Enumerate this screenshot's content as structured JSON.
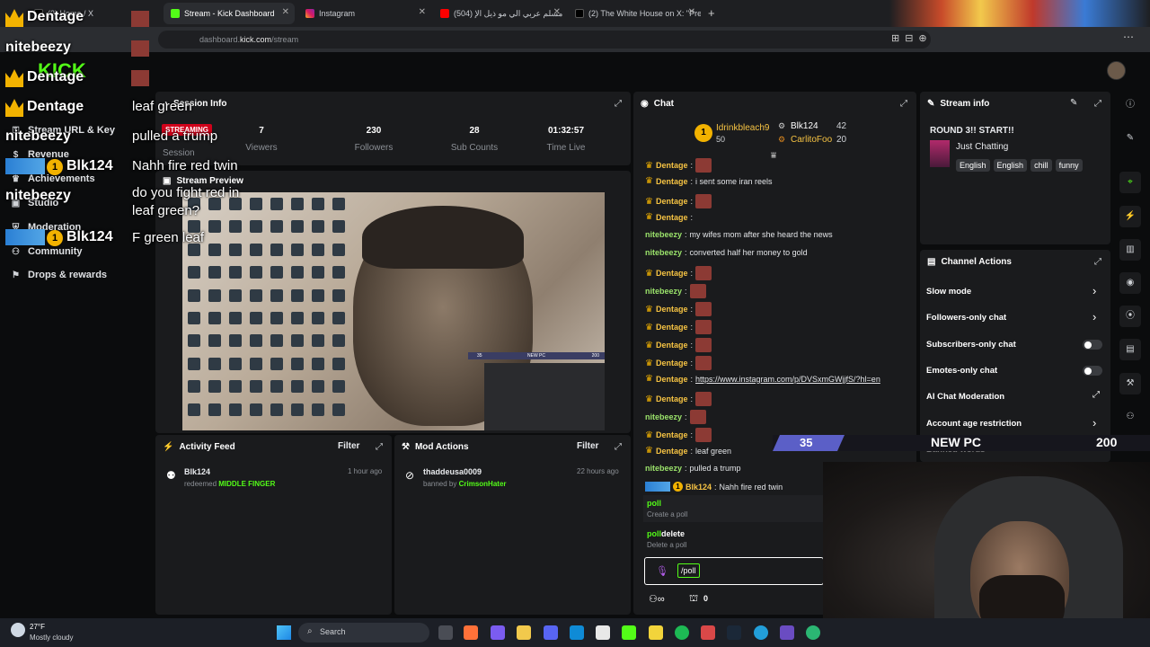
{
  "browser": {
    "tabs": [
      {
        "label": "(2) Home / X"
      },
      {
        "label": "Stream - Kick Dashboard"
      },
      {
        "label": "Instagram"
      },
      {
        "label": "(504) مسلم عربي الي مو ذيل الإ"
      },
      {
        "label": "(2) The White House on X: \"Pre"
      }
    ],
    "url_prefix": "dashboard.",
    "url_domain": "kick.com",
    "url_path": "/stream"
  },
  "sidebar": {
    "items": [
      {
        "label": "Stream URL & Key"
      },
      {
        "label": "Revenue"
      },
      {
        "label": "Achievements"
      },
      {
        "label": "Studio"
      },
      {
        "label": "Moderation"
      },
      {
        "label": "Community"
      },
      {
        "label": "Drops & rewards"
      }
    ]
  },
  "session": {
    "title": "Session Info",
    "status": "STREAMING",
    "session_label": "Session",
    "stats": [
      {
        "value": "7",
        "label": "Viewers"
      },
      {
        "value": "230",
        "label": "Followers"
      },
      {
        "value": "28",
        "label": "Sub Counts"
      },
      {
        "value": "01:32:57",
        "label": "Time Live"
      }
    ]
  },
  "preview": {
    "title": "Stream Preview",
    "overlay_left": "35",
    "overlay_mid": "NEW PC",
    "overlay_right": "200"
  },
  "activity": {
    "title": "Activity Feed",
    "filter": "Filter",
    "item_user": "Blk124",
    "item_time": "1 hour ago",
    "item_action": "redeemed",
    "item_reward": "MIDDLE FINGER"
  },
  "mod": {
    "title": "Mod Actions",
    "filter": "Filter",
    "item_user": "thaddeusa0009",
    "item_time": "22 hours ago",
    "item_action": "banned by",
    "item_by": "CrimsonHater"
  },
  "chat": {
    "title": "Chat",
    "leader1_rank": "1",
    "leader1_name": "Idrinkbleach9",
    "leader1_count": "50",
    "leader2_name": "Blk124",
    "leader2_count": "42",
    "leader3_name": "CarlitoFoo",
    "leader3_count": "20",
    "messages": [
      {
        "user": "Dentage",
        "text": ""
      },
      {
        "user": "Dentage",
        "text": "i sent some iran reels"
      },
      {
        "user": "Dentage",
        "text": ""
      },
      {
        "user": "Dentage",
        "text": ""
      },
      {
        "user": "nitebeezy",
        "text": "my wifes mom after she heard the news"
      },
      {
        "user": "nitebeezy",
        "text": "converted half her money to gold"
      },
      {
        "user": "Dentage",
        "text": ""
      },
      {
        "user": "nitebeezy",
        "text": ""
      },
      {
        "user": "Dentage",
        "text": ""
      },
      {
        "user": "Dentage",
        "text": ""
      },
      {
        "user": "Dentage",
        "text": ""
      },
      {
        "user": "Dentage",
        "text": ""
      },
      {
        "user": "Dentage",
        "text": "https://www.instagram.com/p/DVSxmGWjjfS/?hl=en"
      },
      {
        "user": "Dentage",
        "text": ""
      },
      {
        "user": "nitebeezy",
        "text": ""
      },
      {
        "user": "Dentage",
        "text": ""
      },
      {
        "user": "Dentage",
        "text": "leaf green"
      },
      {
        "user": "nitebeezy",
        "text": "pulled a trump"
      },
      {
        "user": "Blk124",
        "text": "Nahh fire red twin"
      }
    ],
    "suggest1_cmd": "poll",
    "suggest1_desc": "Create a poll",
    "suggest2_cmd": "poll",
    "suggest2_rest": "delete",
    "suggest2_desc": "Delete a poll",
    "input_value": "/poll",
    "footer_count": "0"
  },
  "stream_info": {
    "title": "Stream info",
    "stream_title": "ROUND 3!! START!!",
    "category": "Just Chatting",
    "tags": [
      "English",
      "English",
      "chill",
      "funny"
    ]
  },
  "channel_actions": {
    "title": "Channel Actions",
    "rows": [
      {
        "label": "Slow mode"
      },
      {
        "label": "Followers-only chat"
      },
      {
        "label": "Subscribers-only chat"
      },
      {
        "label": "Emotes-only chat"
      },
      {
        "label": "AI Chat Moderation"
      },
      {
        "label": "Account age restriction"
      },
      {
        "label": "Banned words"
      }
    ]
  },
  "overlay": {
    "names": [
      "Dentage",
      "nitebeezy",
      "Dentage",
      "Dentage",
      "nitebeezy",
      "Blk124",
      "nitebeezy",
      "Blk124"
    ],
    "lines": [
      "leaf green",
      "pulled a trump",
      "Nahh fire red twin",
      "do you fight red in",
      "leaf green?",
      "F green leaf"
    ],
    "rank": "1",
    "bar_left": "35",
    "bar_mid": "NEW PC",
    "bar_right": "200"
  },
  "taskbar": {
    "weather_temp": "27°F",
    "weather_desc": "Mostly cloudy",
    "search": "Search"
  },
  "colors": {
    "kick_green": "#53fc18",
    "crown_gold": "#f2b200",
    "live_red": "#d0021b"
  }
}
